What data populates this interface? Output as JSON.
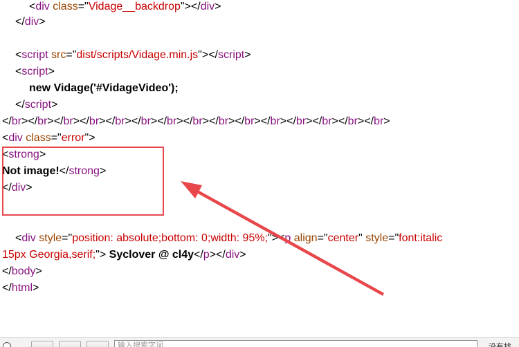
{
  "source": {
    "line1": {
      "lt": "<",
      "tag": "div",
      "sp": " ",
      "attr": "class",
      "eq": "=\"",
      "val": "Vidage__backdrop",
      "close": "\"></",
      "tag2": "div",
      "gt": ">"
    },
    "line2": {
      "lt": "</",
      "tag": "div",
      "gt": ">"
    },
    "line3": {
      "lt": "<",
      "tag": "script",
      "sp": " ",
      "attr": "src",
      "eq": "=\"",
      "val": "dist/scripts/Vidage.min.js",
      "close": "\"></",
      "tag2": "script",
      "gt": ">"
    },
    "line4": {
      "lt": "<",
      "tag": "script",
      "gt": ">"
    },
    "line5": {
      "text": "new Vidage('#VidageVideo');"
    },
    "line6": {
      "lt": "</",
      "tag": "script",
      "gt": ">"
    },
    "line7": {
      "br_pattern": "</br>",
      "count": 15
    },
    "line8": {
      "lt": "<",
      "tag": "div",
      "sp": " ",
      "attr": "class",
      "eq": "=\"",
      "val": "error",
      "close": "\">"
    },
    "line9": {
      "lt": "<",
      "tag": "strong",
      "gt": ">"
    },
    "line10": {
      "text": "Not image!",
      "lt": "</",
      "tag": "strong",
      "gt": ">"
    },
    "line11": {
      "lt": "</",
      "tag": "div",
      "gt": ">"
    },
    "line12": {
      "lt": "<",
      "tag": "div",
      "sp": " ",
      "attr": "style",
      "eq": "=\"",
      "val": "position: absolute;bottom: 0;width: 95%;",
      "close": "\"><",
      "tag2": "p",
      "sp2": " ",
      "attr2": "align",
      "eq2": "=\"",
      "val2": "center",
      "close2": "\" ",
      "attr3": "style",
      "eq3": "=\"",
      "val3": "font:italic"
    },
    "line13": {
      "val": "15px Georgia,serif;",
      "close": "\"> ",
      "text": "Syclover @ cl4y",
      "lt": "</",
      "tag": "p",
      "mid": "></",
      "tag2": "div",
      "gt": ">"
    },
    "line14": {
      "lt": "</",
      "tag": "body",
      "gt": ">"
    },
    "line15": {
      "lt": "</",
      "tag": "html",
      "gt": ">"
    }
  },
  "annotation": {
    "color": "#e8474c"
  },
  "bottom_bar": {
    "input_placeholder": "输入搜索字词",
    "right_text": "没有找"
  }
}
